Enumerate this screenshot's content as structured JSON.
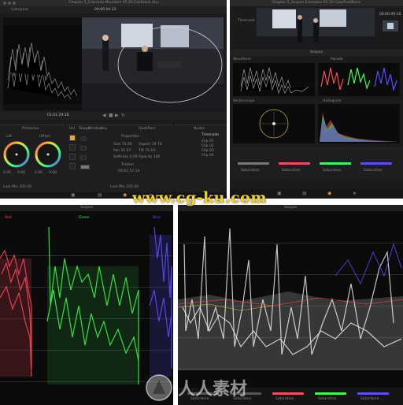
{
  "panel_a": {
    "title": "Chapter 5_Colorado Mountain 05 20 ColdHenk.drp",
    "clip_label": "Colorpure",
    "timecode_left": "01:01:29:18",
    "timecode_right": "00:00:04:13",
    "section_primaries": "Primaries",
    "section_qualifiers": "Qualifiers",
    "section_nodes": "Nodes",
    "wheel_labels": [
      "Lift",
      "Offset"
    ],
    "wheel_values": [
      "0.00",
      "0.00",
      "0.00",
      "0.00"
    ],
    "toolbar_cols": [
      "Hsl",
      "Shape",
      "Window",
      "Key"
    ],
    "node_panel_title": "Properties",
    "readouts": [
      "Size 70.00",
      "Aspect 19.70",
      "Pan 55.07",
      "Tilt 76.14",
      "Softness 0.00",
      "Opacity 100"
    ],
    "tracker_label": "Tracker",
    "tracker_value": "00:01:57:13",
    "bottom_left": "Lum Mix 100.00",
    "bottom_right": "Lum Mix 100.00",
    "nodes": [
      "Timecode",
      "Clip 01",
      "Clip 02",
      "Clip 03",
      "Clip 04"
    ]
  },
  "panel_b": {
    "title": "Chapter 5_Scopes Examples 05 20 ColorFestBlanc",
    "scope_title": "Scopes",
    "waveform_label": "Waveform",
    "parade_label": "Parade",
    "vectorscope_label": "Vectorscope",
    "histogram_label": "Histogram",
    "parade_channels": [
      "Red",
      "Green",
      "Blue"
    ],
    "readouts": [
      "Luminance",
      "Luminance",
      "Luminance"
    ],
    "node_items": [
      "Timecode",
      "Clip 01",
      "Clip 02",
      "Clip 03"
    ],
    "timecode": "00:00:09:10",
    "bottom_labels": [
      "Saturation",
      "Saturation",
      "Saturation",
      "Saturation"
    ]
  },
  "panel_c": {
    "title": "Scopes",
    "channels": [
      "Red",
      "Green",
      "Blue"
    ]
  },
  "panel_d": {
    "title": "Scopes",
    "bottom_labels": [
      "Saturation",
      "Saturation",
      "Saturation",
      "Saturation",
      "Saturation"
    ]
  },
  "watermarks": {
    "url": "www.cg-ku.com",
    "cn_text": "人人素材"
  },
  "colors": {
    "panel_bg": "#1b1b1c",
    "title_bar": "#2a2a2c",
    "accent_orange": "#e8a33c",
    "red_channel": "#ff4a5a",
    "green_channel": "#3cff50",
    "blue_channel": "#5a4cff",
    "watermark_yellow": "#f4d22a"
  }
}
